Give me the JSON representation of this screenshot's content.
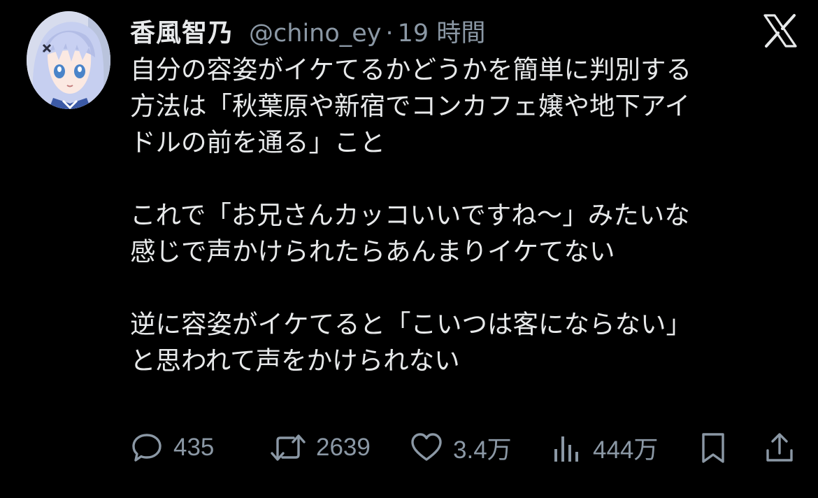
{
  "tweet": {
    "display_name": "香風智乃",
    "handle": "@chino_ey",
    "separator": "·",
    "time": "19 時間",
    "body_lines": [
      "自分の容姿がイケてるかどうかを簡単に判別する",
      "方法は「秋葉原や新宿でコンカフェ嬢や地下アイ",
      "ドルの前を通る」こと",
      "",
      "これで「お兄さんカッコいいですね〜」みたいな",
      "感じで声かけられたらあんまりイケてない",
      "",
      "逆に容姿がイケてると「こいつは客にならない」",
      "と思われて声をかけられない"
    ]
  },
  "actions": {
    "reply_count": "435",
    "repost_count": "2639",
    "like_count": "3.4万",
    "views_count": "444万"
  },
  "icons": {
    "brand": "x-logo-icon",
    "reply": "reply-icon",
    "repost": "repost-icon",
    "like": "heart-icon",
    "views": "views-icon",
    "bookmark": "bookmark-icon",
    "share": "share-icon"
  },
  "colors": {
    "background": "#000000",
    "text": "#e7e9ea",
    "secondary": "#8b98a5"
  }
}
